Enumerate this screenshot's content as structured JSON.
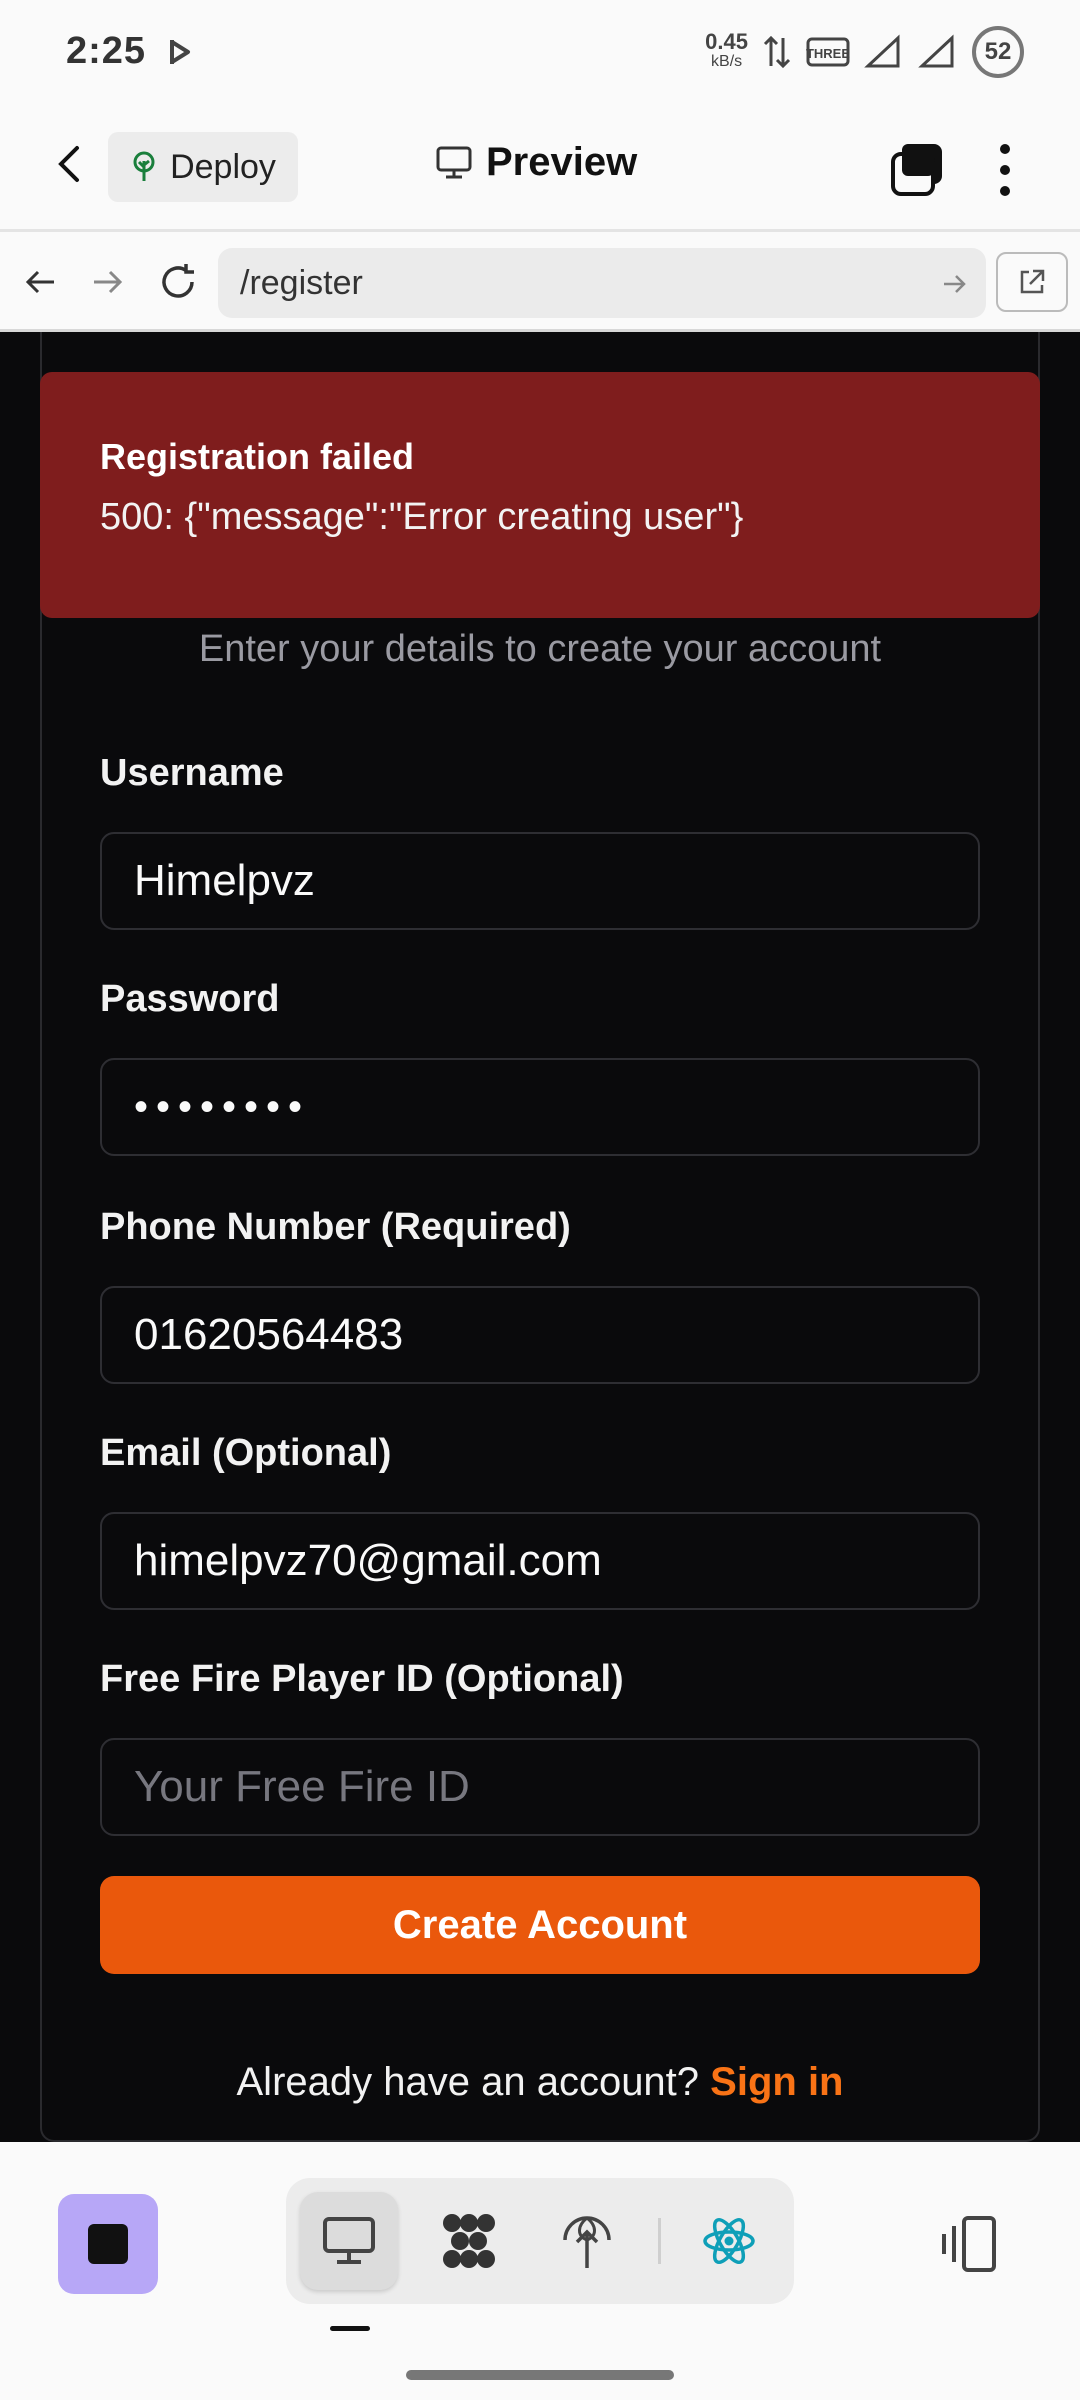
{
  "status_bar": {
    "time": "2:25",
    "net_speed": "0.45",
    "net_unit": "kB/s",
    "battery": "52"
  },
  "header": {
    "deploy_label": "Deploy",
    "title": "Preview"
  },
  "url_bar": {
    "path": "/register"
  },
  "toast": {
    "title": "Registration failed",
    "message": "500: {\"message\":\"Error creating user\"}",
    "bg_color": "#7f1d1d"
  },
  "form": {
    "subtitle": "Enter your details to create your account",
    "fields": [
      {
        "label": "Username",
        "value": "Himelpvz"
      },
      {
        "label": "Password",
        "value": "••••••••"
      },
      {
        "label": "Phone Number (Required)",
        "value": "01620564483"
      },
      {
        "label": "Email (Optional)",
        "value": "himelpvz70@gmail.com"
      },
      {
        "label": "Free Fire Player ID (Optional)",
        "placeholder": "Your Free Fire ID"
      }
    ],
    "submit_label": "Create Account",
    "signin_prompt": "Already have an account?",
    "signin_link": "Sign in",
    "accent_color": "#ea580c"
  },
  "bottom_bar": {
    "stop_color": "#b7a7f7",
    "icons": [
      "desktop-icon",
      "components-icon",
      "network-globe-icon",
      "react-icon"
    ]
  }
}
